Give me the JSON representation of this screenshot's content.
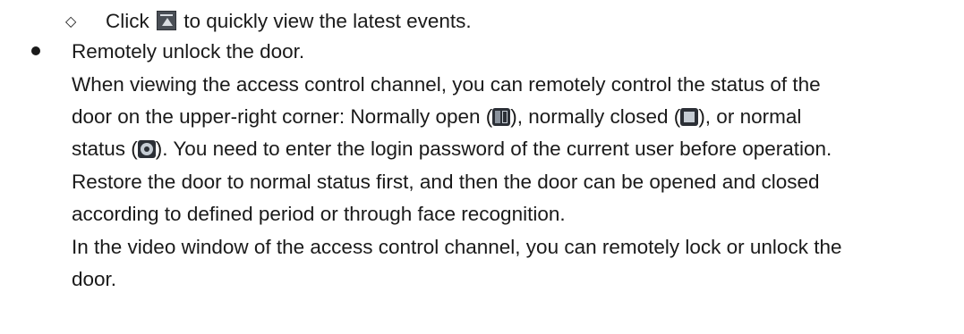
{
  "sub_bullet": {
    "marker": "◇",
    "before_icon": "Click",
    "icon": "latest-events-icon",
    "after_icon": "to quickly view the latest events."
  },
  "bullet": {
    "title": "Remotely unlock the door."
  },
  "para1": {
    "line1": "When viewing the access control channel, you can remotely control the status of the",
    "line2_a": "door on the upper-right corner: Normally open (",
    "line2_b": "), normally closed (",
    "line2_c": "), or normal",
    "line3_a": "status (",
    "line3_b": "). You need to enter the login password of the current user before operation.",
    "line4": "Restore the door to normal status first, and then the door can be opened and closed",
    "line5": "according to defined period or through face recognition."
  },
  "para2": {
    "line1": "In the video window of the access control channel, you can remotely lock or unlock the",
    "line2": "door."
  },
  "icons": {
    "open": "normally-open-icon",
    "closed": "normally-closed-icon",
    "normal": "normal-status-icon"
  }
}
